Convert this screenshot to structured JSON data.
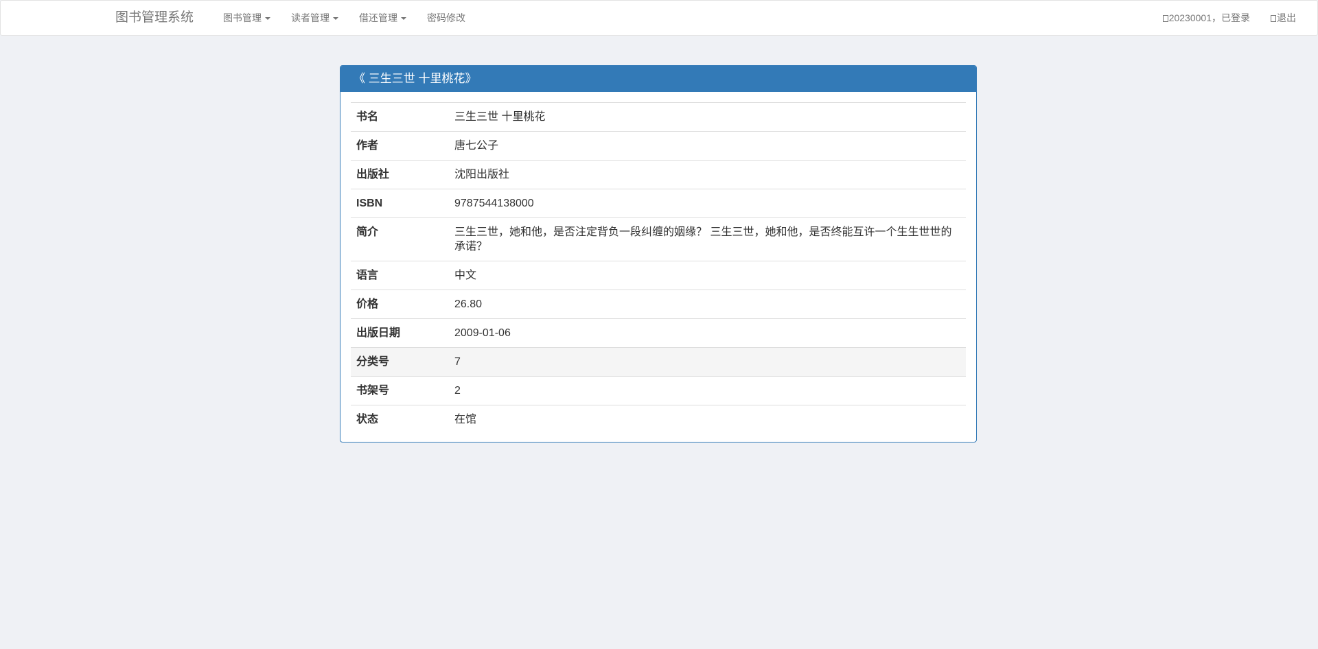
{
  "navbar": {
    "brand": "图书管理系统",
    "menus": [
      {
        "label": "图书管理",
        "dropdown": true
      },
      {
        "label": "读者管理",
        "dropdown": true
      },
      {
        "label": "借还管理",
        "dropdown": true
      },
      {
        "label": "密码修改",
        "dropdown": false
      }
    ],
    "user_status": "20230001，已登录",
    "logout": "退出"
  },
  "panel": {
    "title": "《 三生三世 十里桃花》",
    "rows": [
      {
        "key": "书名",
        "value": "三生三世 十里桃花"
      },
      {
        "key": "作者",
        "value": "唐七公子"
      },
      {
        "key": "出版社",
        "value": "沈阳出版社"
      },
      {
        "key": "ISBN",
        "value": "9787544138000"
      },
      {
        "key": "简介",
        "value": "三生三世，她和他，是否注定背负一段纠缠的姻缘？ 三生三世，她和他，是否终能互许一个生生世世的承诺？"
      },
      {
        "key": "语言",
        "value": "中文"
      },
      {
        "key": "价格",
        "value": "26.80"
      },
      {
        "key": "出版日期",
        "value": "2009-01-06"
      },
      {
        "key": "分类号",
        "value": "7"
      },
      {
        "key": "书架号",
        "value": "2"
      },
      {
        "key": "状态",
        "value": "在馆"
      }
    ]
  },
  "colors": {
    "primary": "#337ab7",
    "background": "#eff1f5",
    "row_hover": "#f5f5f5"
  },
  "icons": {
    "user": "user-icon",
    "logout": "logout-icon"
  }
}
